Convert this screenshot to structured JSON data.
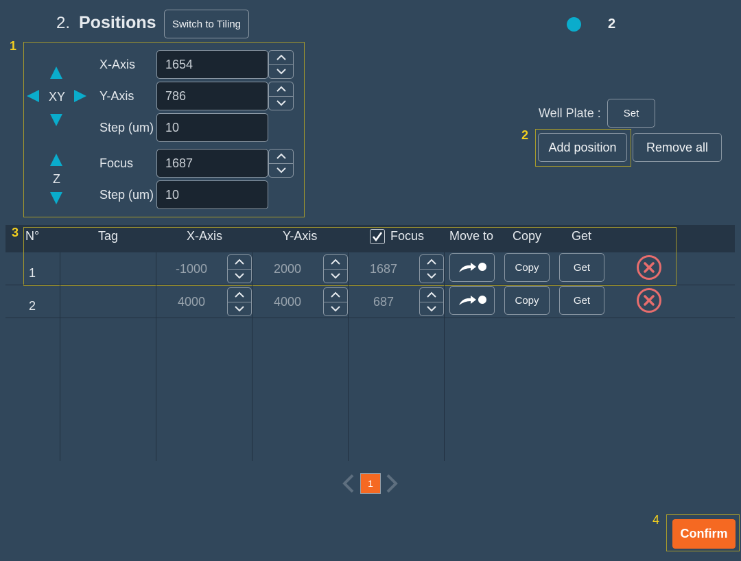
{
  "header": {
    "step_number": "2.",
    "title": "Positions",
    "switch_button": "Switch to Tiling",
    "status_dot_color": "#0aaccc",
    "position_count": "2"
  },
  "annotations": [
    "1",
    "2",
    "3",
    "4"
  ],
  "controls": {
    "xy_label": "XY",
    "z_label": "Z",
    "x_axis_label": "X-Axis",
    "x_axis_value": "1654",
    "y_axis_label": "Y-Axis",
    "y_axis_value": "786",
    "xy_step_label": "Step (um)",
    "xy_step_value": "10",
    "focus_label": "Focus",
    "focus_value": "1687",
    "z_step_label": "Step (um)",
    "z_step_value": "10"
  },
  "well_plate": {
    "label": "Well Plate :",
    "set_button": "Set"
  },
  "actions": {
    "add_position": "Add position",
    "remove_all": "Remove all"
  },
  "table": {
    "columns": {
      "number": "N°",
      "tag": "Tag",
      "x_axis": "X-Axis",
      "y_axis": "Y-Axis",
      "focus": "Focus",
      "move_to": "Move to",
      "copy": "Copy",
      "get": "Get"
    },
    "focus_checked": true,
    "rows": [
      {
        "number": "1",
        "tag": "",
        "x": "-1000",
        "y": "2000",
        "focus": "1687",
        "copy": "Copy",
        "get": "Get"
      },
      {
        "number": "2",
        "tag": "",
        "x": "4000",
        "y": "4000",
        "focus": "687",
        "copy": "Copy",
        "get": "Get"
      }
    ]
  },
  "pagination": {
    "current_page": "1"
  },
  "footer": {
    "confirm": "Confirm",
    "accent_color": "#f56922"
  }
}
